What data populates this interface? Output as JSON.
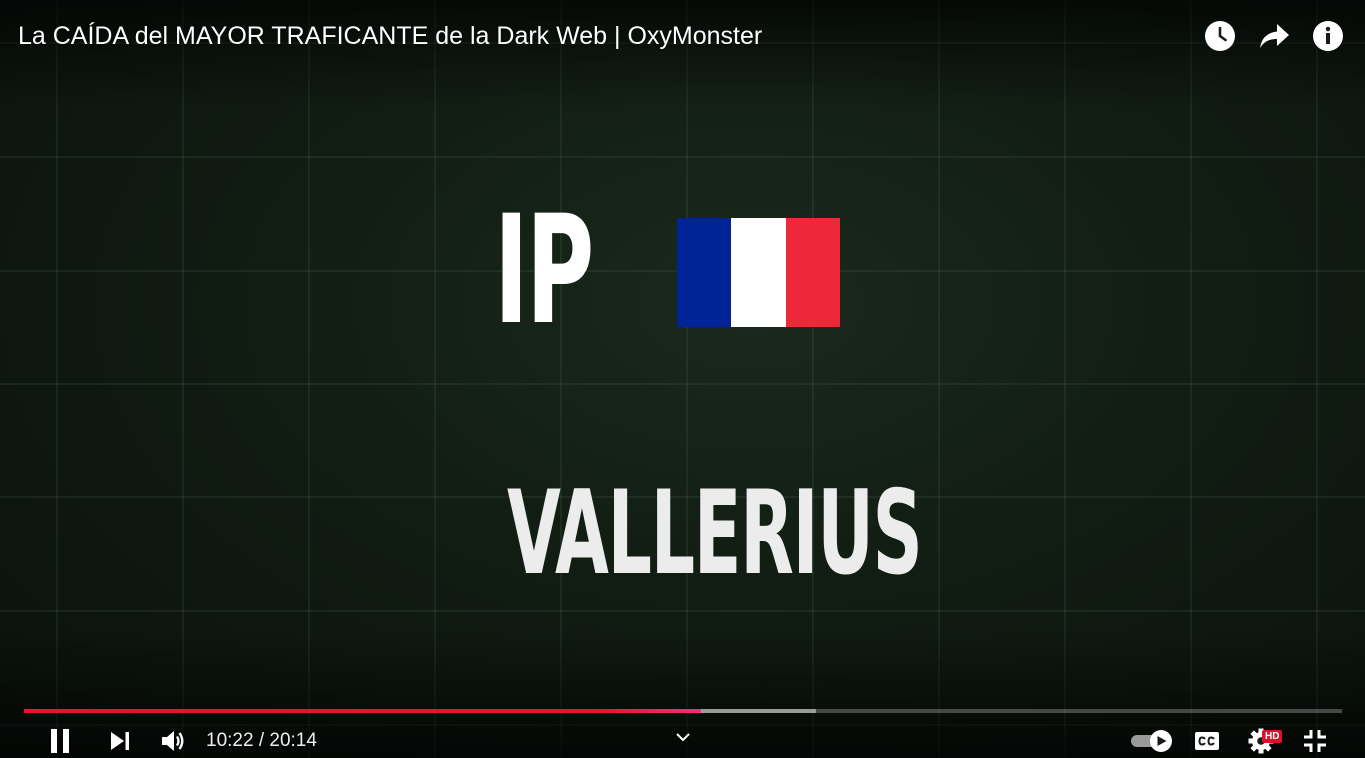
{
  "video": {
    "title": "La CAÍDA del MAYOR TRAFICANTE de la Dark Web | OxyMonster"
  },
  "top_actions": [
    {
      "name": "watch-later",
      "icon": "clock-icon"
    },
    {
      "name": "share",
      "icon": "share-arrow-icon"
    },
    {
      "name": "info",
      "icon": "info-icon"
    }
  ],
  "frame": {
    "ip_label": "IP",
    "name_label": "VALLERIUS",
    "flag_colors": [
      "#002395",
      "#ffffff",
      "#ED2939"
    ]
  },
  "progress": {
    "played_fraction": 0.514,
    "buffered_fraction": 0.601
  },
  "controls": {
    "current_time": "10:22",
    "separator": " / ",
    "duration": "20:14",
    "hd_badge": "HD"
  },
  "colors": {
    "accent": "#ff0000",
    "background": "#0c130e"
  }
}
